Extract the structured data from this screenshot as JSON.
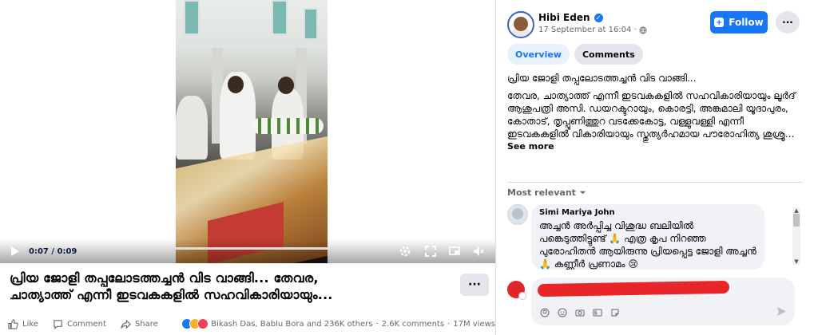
{
  "video": {
    "time": "0:07 / 0:09",
    "progress_fraction": 0.67
  },
  "post": {
    "title_line1": "പ്രിയ ജോളി തപ്പലോടത്തച്ചൻ വിട വാങ്ങി... തേവര,",
    "title_line2": "ചാത്യാത്ത് എന്നീ ഇടവകകളിൽ സഹവികാരിയായും...",
    "more_label": "···"
  },
  "actions": {
    "like": "Like",
    "comment": "Comment",
    "share": "Share",
    "reactions_text": "Bikash Das, Bablu Bora and 236K others",
    "comments_count": "2.6K comments",
    "views": "17M views"
  },
  "author": {
    "name": "Hibi Eden",
    "date": "17 September at 16:04 ·"
  },
  "buttons": {
    "follow": "Follow",
    "menu": "···"
  },
  "tabs": [
    {
      "label": "Overview"
    },
    {
      "label": "Comments"
    }
  ],
  "caption": {
    "line1": "പ്രിയ ജോളി തപ്പലോടത്തച്ചൻ വിട വാങ്ങി...",
    "para": "തേവര, ചാത്യാത്ത് എന്നീ ഇടവകകളിൽ സഹവികാരിയായും ലൂർദ് ആശുപത്രി അസി. ഡയറക്ടറായും, കൊരട്ടി, അങ്കമാലി യൂദാപുരം, കോതാട്, തൃപ്പൂണിത്തുറ വടക്കേകോട്ട, വള്ളുവള്ളി എന്നീ ഇടവകകളിൽ വികാരിയായും സ്തുത്യർഹമായ പൗരോഹിത്യ ശുശ്രൂ...",
    "see_more": "See more"
  },
  "comments": {
    "sort_label": "Most relevant",
    "items": [
      {
        "author": "Simi Mariya John",
        "text": "അച്ചൻ അർപ്പിച്ച വിശുദ്ധ ബലിയിൽ പങ്കെടുത്തിട്ടുണ്ട് 🙏 എത്ര കൃപ നിറഞ്ഞ പുരോഹിതൻ ആയിരുന്നു പ്രിയപ്പെട്ട ജോളി അച്ചൻ 🙏 കണ്ണീർ പ്രണാമം 😢"
      }
    ]
  },
  "colors": {
    "accent": "#1877f2",
    "redaction": "#e8262a"
  }
}
